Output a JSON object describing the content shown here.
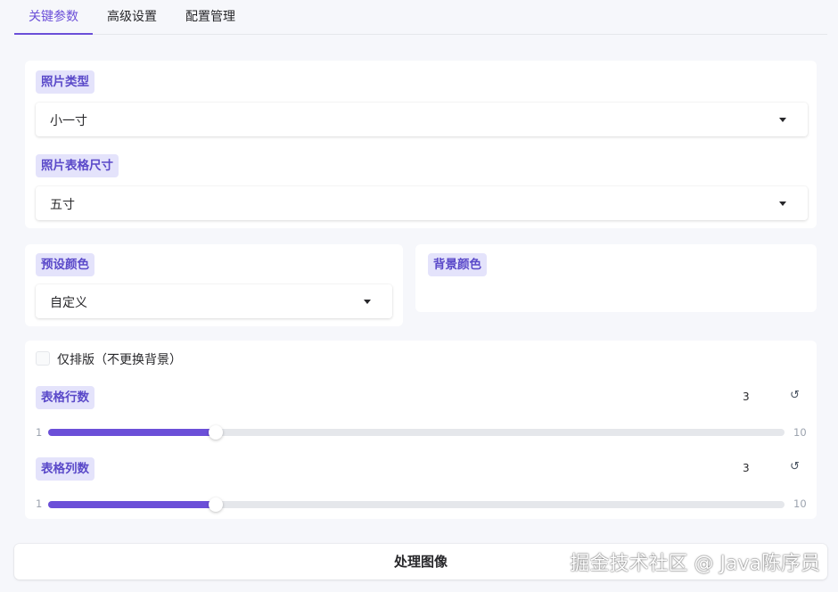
{
  "tabs": [
    {
      "label": "关键参数",
      "active": true
    },
    {
      "label": "高级设置",
      "active": false
    },
    {
      "label": "配置管理",
      "active": false
    }
  ],
  "photo_type": {
    "label": "照片类型",
    "value": "小一寸"
  },
  "sheet_size": {
    "label": "照片表格尺寸",
    "value": "五寸"
  },
  "preset_color": {
    "label": "预设颜色",
    "value": "自定义"
  },
  "background_color": {
    "label": "背景颜色"
  },
  "layout_only": {
    "label": "仅排版（不更换背景）",
    "checked": false
  },
  "rows": {
    "label": "表格行数",
    "value": "3",
    "min": "1",
    "max": "10",
    "reset_icon": "↺"
  },
  "cols": {
    "label": "表格列数",
    "value": "3",
    "min": "1",
    "max": "10",
    "reset_icon": "↺"
  },
  "process_button": {
    "label": "处理图像"
  },
  "watermark": "掘金技术社区 @ Java陈序员",
  "colors": {
    "accent": "#6b4fd8",
    "badge_bg": "#e4e3fb",
    "badge_text": "#5a49c9"
  }
}
